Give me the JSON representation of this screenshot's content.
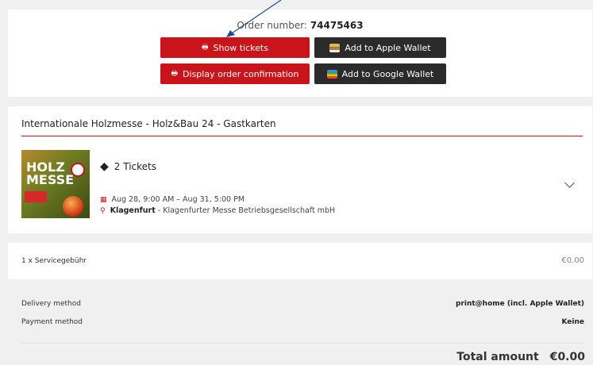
{
  "order": {
    "number_label": "Order number:",
    "number_value": "74475463"
  },
  "buttons": {
    "show_tickets": "Show tickets",
    "apple_wallet": "Add to Apple Wallet",
    "display_confirmation": "Display order confirmation",
    "google_wallet": "Add to Google Wallet"
  },
  "event": {
    "title": "Internationale Holzmesse - Holz&Bau 24 - Gastkarten",
    "image_text": "HOLZ MESSE",
    "tickets": "2 Tickets",
    "date_range": "Aug 28, 9:00 AM – Aug 31, 5:00 PM",
    "venue_city": "Klagenfurt",
    "venue_detail": " - Klagenfurter Messe Betriebsgesellschaft mbH"
  },
  "fee": {
    "label": "1 x Servicegebühr",
    "value": "€0.00"
  },
  "summary": {
    "delivery_label": "Delivery method",
    "delivery_value": "print@home (incl. Apple Wallet)",
    "payment_label": "Payment method",
    "payment_value": "Keine",
    "total_label": "Total amount",
    "total_value": "€0.00"
  },
  "colors": {
    "primary_red": "#c8141a",
    "dark_button": "#2b2b2b",
    "annotation_arrow": "#1e4d8c"
  }
}
